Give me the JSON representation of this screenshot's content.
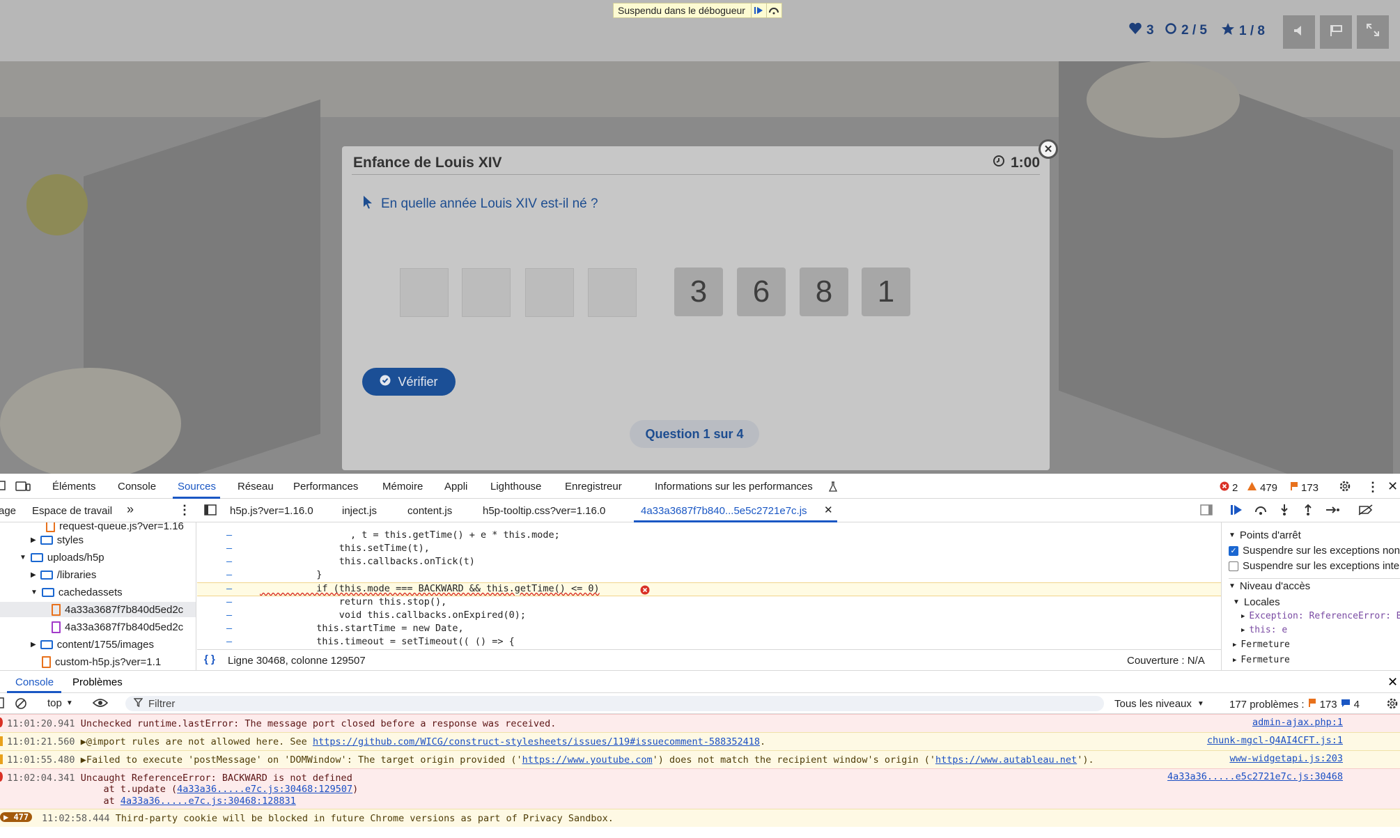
{
  "debugger_banner": {
    "label": "Suspendu dans le débogueur"
  },
  "game_header": {
    "lives": "3",
    "progress": "2 / 5",
    "stars": "1 / 8"
  },
  "dialog": {
    "title": "Enfance de Louis XIV",
    "timer": "1:00",
    "question": "En quelle année Louis XIV est-il né ?",
    "answer_digits": [
      "3",
      "6",
      "8",
      "1"
    ],
    "verify_label": "Vérifier",
    "question_counter": "Question 1 sur 4"
  },
  "devtools": {
    "tabs": [
      "Éléments",
      "Console",
      "Sources",
      "Réseau",
      "Performances",
      "Mémoire",
      "Appli",
      "Lighthouse",
      "Enregistreur",
      "Informations sur les performances"
    ],
    "active_tab": "Sources",
    "error_count": "2",
    "warning_count": "479",
    "issue_count": "173",
    "navigator_tabs": [
      "age",
      "Espace de travail"
    ],
    "file_tabs": [
      "h5p.js?ver=1.16.0",
      "inject.js",
      "content.js",
      "h5p-tooltip.css?ver=1.16.0",
      "4a33a3687f7b840...5e5c2721e7c.js"
    ],
    "tree": [
      {
        "label": "request-queue.js?ver=1.16",
        "type": "file"
      },
      {
        "label": "styles",
        "type": "folder"
      },
      {
        "label": "uploads/h5p",
        "type": "folder"
      },
      {
        "label": "/libraries",
        "type": "folder"
      },
      {
        "label": "cachedassets",
        "type": "folder"
      },
      {
        "label": "4a33a3687f7b840d5ed2c",
        "type": "file"
      },
      {
        "label": "4a33a3687f7b840d5ed2c",
        "type": "css"
      },
      {
        "label": "content/1755/images",
        "type": "folder"
      },
      {
        "label": "custom-h5p.js?ver=1.1",
        "type": "file"
      }
    ],
    "code_lines": [
      "                , t = this.getTime() + e * this.mode;",
      "              this.setTime(t),",
      "              this.callbacks.onTick(t)",
      "          }",
      "          if (this.mode === BACKWARD && this.getTime() <= 0)",
      "              return this.stop(),",
      "              void this.callbacks.onExpired(0);",
      "          this.startTime = new Date,",
      "          this.timeout = setTimeout(( () => {"
    ],
    "status_position": "Ligne 30468, colonne 129507",
    "coverage": "Couverture : N/A",
    "right_pane": {
      "breakpoints_header": "Points d'arrêt",
      "pause_uncaught": "Suspendre sur les exceptions non interceptées",
      "pause_caught": "Suspendre sur les exceptions interceptées",
      "scope_header": "Niveau d'accès",
      "local_header": "Locales",
      "exception_row": "Exception: ReferenceError: BACKWARD",
      "this_row": "this: e",
      "closure1": "Fermeture",
      "closure2": "Fermeture"
    },
    "drawer_tabs": [
      "Console",
      "Problèmes"
    ],
    "console_context": "top",
    "filter_placeholder": "Filtrer",
    "levels": "Tous les niveaux",
    "problems_summary": "177 problèmes :",
    "problems_warn": "173",
    "problems_info": "4",
    "messages": [
      {
        "type": "error",
        "time": "11:01:20.941",
        "text": "Unchecked runtime.lastError: The message port closed before a response was received.",
        "source": "admin-ajax.php:1"
      },
      {
        "type": "warning",
        "time": "11:01:21.560",
        "text": "▶@import rules are not allowed here. See ",
        "link": "https://github.com/WICG/construct-stylesheets/issues/119#issuecomment-588352418",
        "text_after": ".",
        "source": "chunk-mgcl-Q4AI4CFT.js:1"
      },
      {
        "type": "warning",
        "time": "11:01:55.480",
        "text": "▶Failed to execute 'postMessage' on 'DOMWindow': The target origin provided ('",
        "link": "https://www.youtube.com",
        "text_after": "') does not match the recipient window's origin ('",
        "link2": "https://www.autableau.net",
        "text_after2": "').",
        "source": "www-widgetapi.js:203"
      },
      {
        "type": "error",
        "time": "11:02:04.341",
        "text": "Uncaught ReferenceError: BACKWARD is not defined",
        "line2_prefix": "    at t.update (",
        "line2_link": "4a33a36.....e7c.js:30468:129507",
        "line2_suffix": ")",
        "line3_prefix": "    at ",
        "line3_link": "4a33a36.....e7c.js:30468:128831",
        "source": "4a33a36.....e5c2721e7c.js:30468"
      },
      {
        "type": "warning",
        "badge": "477",
        "time": "11:02:58.444",
        "text": "Third-party cookie will be blocked in future Chrome versions as part of Privacy Sandbox."
      }
    ]
  }
}
